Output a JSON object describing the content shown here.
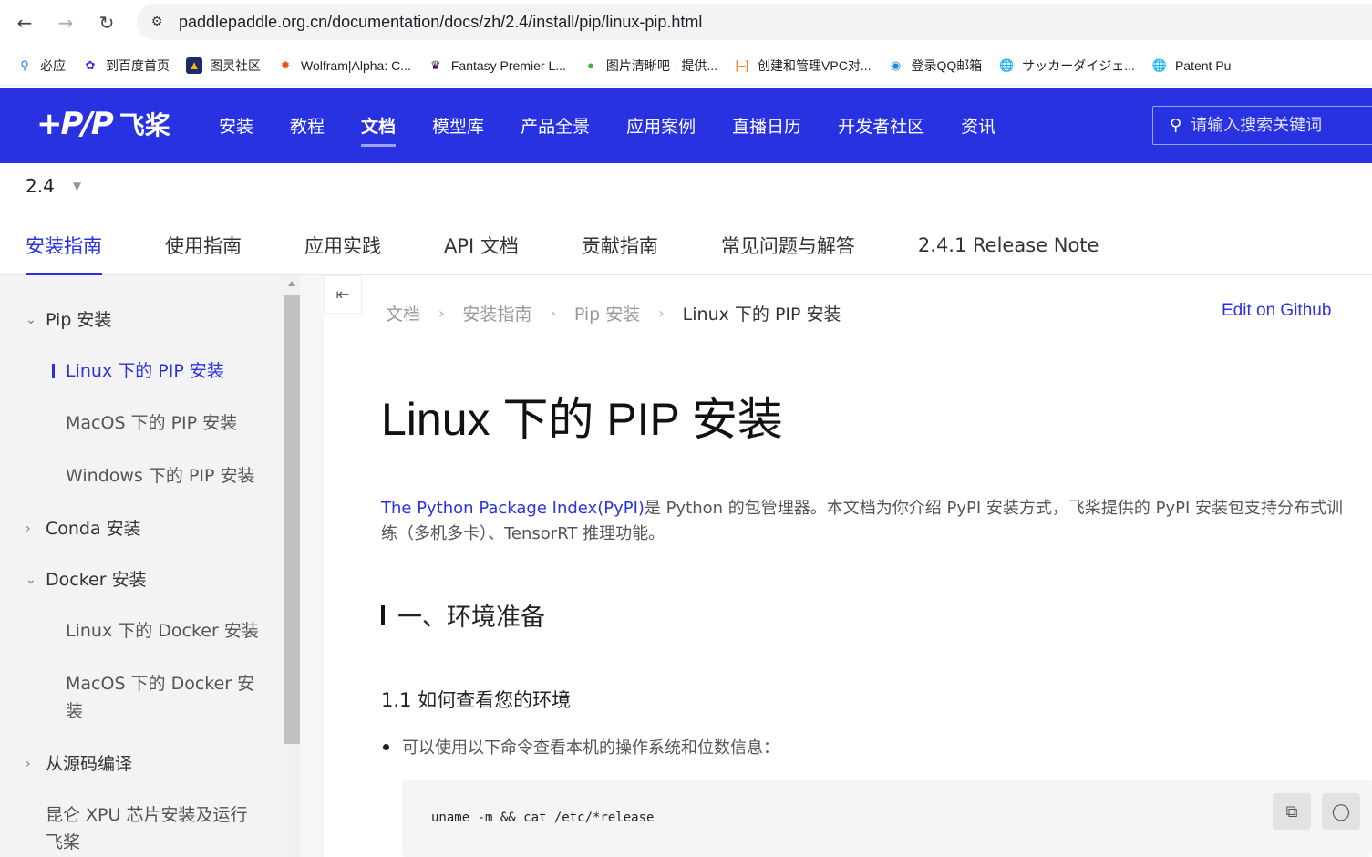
{
  "browser": {
    "url": "paddlepaddle.org.cn/documentation/docs/zh/2.4/install/pip/linux-pip.html",
    "bookmarks": [
      {
        "label": "必应",
        "icon": "search-icon"
      },
      {
        "label": "到百度首页",
        "icon": "baidu-icon"
      },
      {
        "label": "图灵社区",
        "icon": "turing-icon"
      },
      {
        "label": "Wolfram|Alpha: C...",
        "icon": "wolfram-icon"
      },
      {
        "label": "Fantasy Premier L...",
        "icon": "premier-league-icon"
      },
      {
        "label": "图片清晰吧 - 提供...",
        "icon": "image-icon"
      },
      {
        "label": "创建和管理VPC对...",
        "icon": "cloud-icon"
      },
      {
        "label": "登录QQ邮箱",
        "icon": "qq-mail-icon"
      },
      {
        "label": "サッカーダイジェ...",
        "icon": "globe-icon"
      },
      {
        "label": "Patent Pu",
        "icon": "globe-icon"
      }
    ]
  },
  "header": {
    "logo_mark": "+P/P",
    "logo_text": "飞桨",
    "nav": [
      "安装",
      "教程",
      "文档",
      "模型库",
      "产品全景",
      "应用案例",
      "直播日历",
      "开发者社区",
      "资讯"
    ],
    "active_nav": "文档",
    "search_placeholder": "请输入搜索关键词"
  },
  "version": "2.4",
  "doc_tabs": [
    "安装指南",
    "使用指南",
    "应用实践",
    "API 文档",
    "贡献指南",
    "常见问题与解答",
    "2.4.1 Release Note"
  ],
  "sidebar": {
    "items": [
      {
        "label": "Pip 安装",
        "level": 0,
        "arrow": "expanded"
      },
      {
        "label": "Linux 下的 PIP 安装",
        "level": 1,
        "active": true
      },
      {
        "label": "MacOS 下的 PIP 安装",
        "level": 1
      },
      {
        "label": "Windows 下的 PIP 安装",
        "level": 1
      },
      {
        "label": "Conda 安装",
        "level": 0,
        "arrow": "collapsed"
      },
      {
        "label": "Docker 安装",
        "level": 0,
        "arrow": "expanded"
      },
      {
        "label": "Linux 下的 Docker 安装",
        "level": 1
      },
      {
        "label": "MacOS 下的 Docker 安",
        "label2": "装",
        "level": 1
      },
      {
        "label": "从源码编译",
        "level": 0,
        "arrow": "collapsed"
      },
      {
        "label": "昆仑 XPU 芯片安装及运行",
        "label2": "飞桨",
        "level": 0
      }
    ]
  },
  "breadcrumb": [
    "文档",
    "安装指南",
    "Pip 安装",
    "Linux 下的 PIP 安装"
  ],
  "edit_link": "Edit on Github",
  "content": {
    "title": "Linux 下的 PIP 安装",
    "intro_link": "The Python Package Index(PyPI)",
    "intro_line1": "是 Python 的包管理器。本文档为你介绍 PyPI 安装方式，飞桨提供的 PyPI 安装包支持分布式训",
    "intro_line2": "练（多机多卡）、TensorRT 推理功能。",
    "h2": "一、环境准备",
    "h3": "1.1 如何查看您的环境",
    "bullet": "可以使用以下命令查看本机的操作系统和位数信息：",
    "code": "uname -m && cat /etc/*release"
  }
}
